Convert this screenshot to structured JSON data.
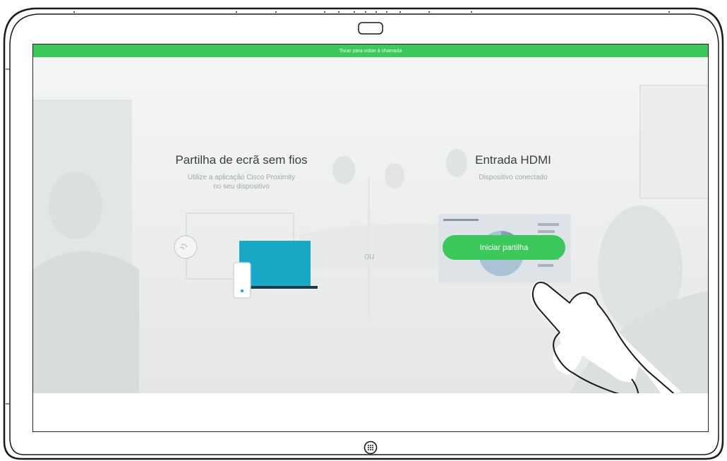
{
  "banner": {
    "text": "Tocar para voltar à chamada"
  },
  "wireless": {
    "title": "Partilha de ecrã sem fios",
    "subtitle_line1": "Utilize a aplicação Cisco Proximity",
    "subtitle_line2": "no seu dispositivo"
  },
  "separator": {
    "text": "ou"
  },
  "hdmi": {
    "title": "Entrada HDMI",
    "subtitle": "Dispositivo conectado",
    "button_label": "Iniciar partilha"
  },
  "colors": {
    "accent_green": "#3cc85a",
    "laptop_teal": "#19a9c6"
  },
  "icons": [
    "camera-icon",
    "proximity-icon",
    "laptop-icon",
    "phone-icon",
    "hand-icon",
    "home-icon"
  ]
}
